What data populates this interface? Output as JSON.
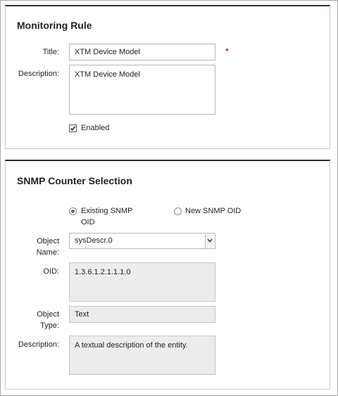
{
  "monitoring_rule": {
    "heading": "Monitoring Rule",
    "title_label": "Title:",
    "title_value": "XTM Device Model",
    "required_marker": "*",
    "description_label": "Description:",
    "description_value": "XTM Device Model",
    "enabled_label": "Enabled",
    "enabled_checked": true
  },
  "snmp": {
    "heading": "SNMP Counter Selection",
    "existing_line1": "Existing SNMP",
    "existing_line2": "OID",
    "new_label": "New SNMP OID",
    "selected": "existing",
    "object_name_label_1": "Object",
    "object_name_label_2": "Name:",
    "object_name_value": "sysDescr.0",
    "oid_label": "OID:",
    "oid_value": "1.3.6.1.2.1.1.1.0",
    "object_type_label_1": "Object",
    "object_type_label_2": "Type:",
    "object_type_value": "Text",
    "description_label": "Description:",
    "description_value": "A textual description of the entity."
  }
}
